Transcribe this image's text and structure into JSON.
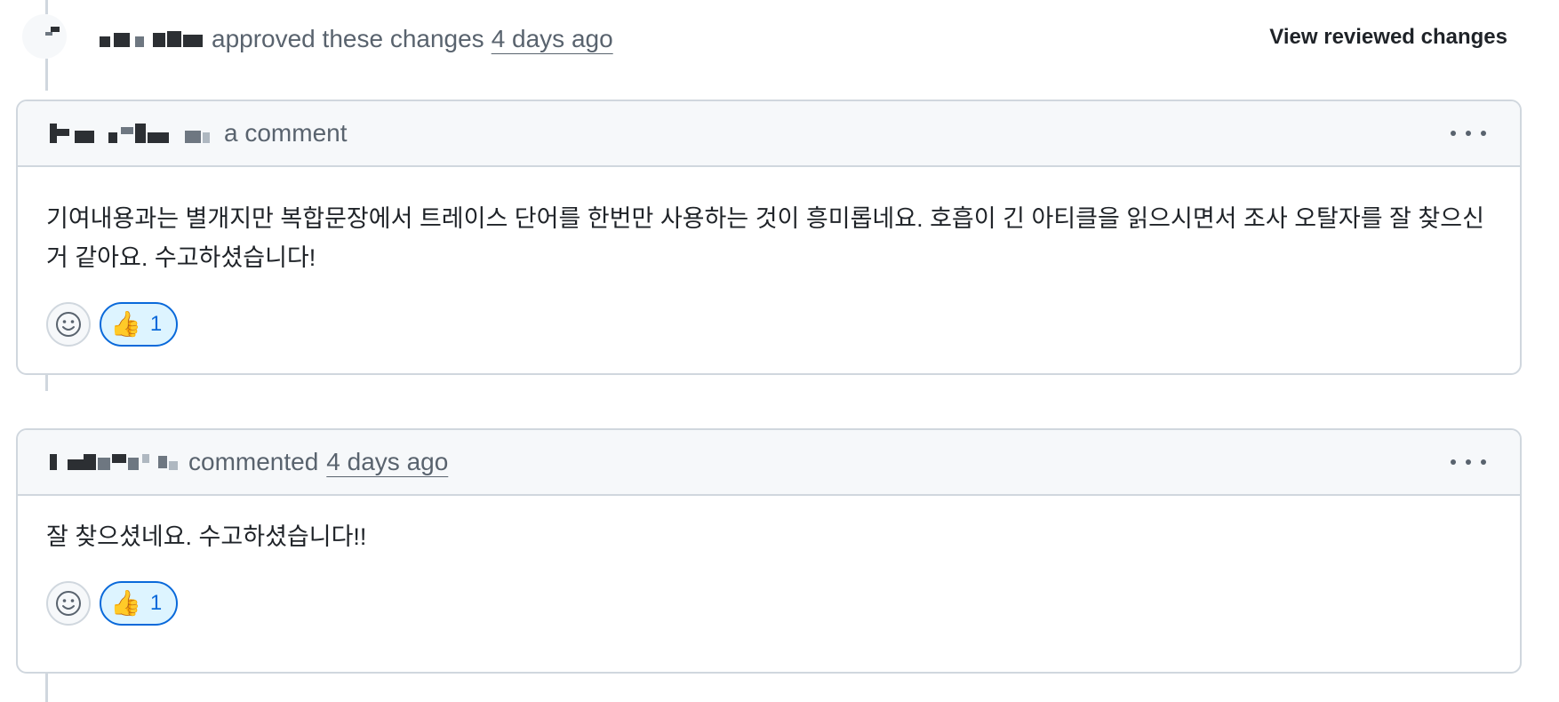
{
  "review_event": {
    "action_text": "approved these changes",
    "timestamp": "4 days ago",
    "view_changes_label": "View reviewed changes"
  },
  "comments": [
    {
      "action_text": "a comment",
      "timestamp": "",
      "body": "기여내용과는 별개지만 복합문장에서 트레이스 단어를 한번만 사용하는 것이 흥미롭네요. 호흡이 긴 아티클을 읽으시면서 조사 오탈자를 잘 찾으신 거 같아요. 수고하셨습니다!",
      "reaction": {
        "emoji": "👍",
        "count": "1"
      }
    },
    {
      "action_text": "commented",
      "timestamp": "4 days ago",
      "body": "잘 찾으셨네요. 수고하셨습니다!!",
      "reaction": {
        "emoji": "👍",
        "count": "1"
      }
    }
  ],
  "icons": {
    "more_options": "kebab-horizontal-icon",
    "add_reaction": "smiley-icon"
  },
  "colors": {
    "accent": "#0969da",
    "reaction_bg": "#ddf4ff",
    "border": "#d0d7de",
    "header_bg": "#f6f8fa",
    "muted_text": "#59636e"
  }
}
